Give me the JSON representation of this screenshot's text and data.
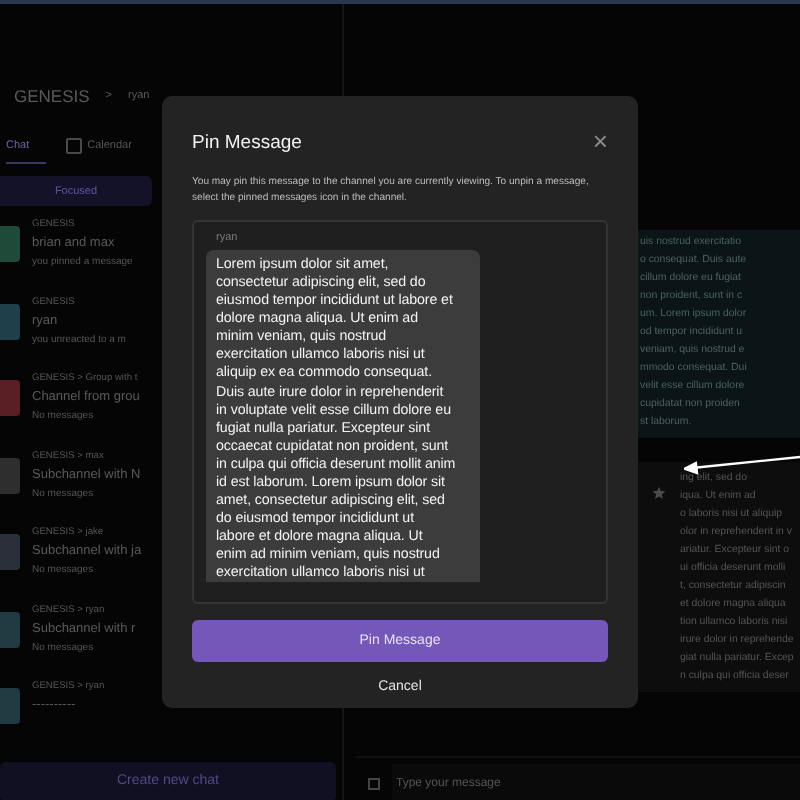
{
  "header": {
    "workspace": "GENESIS",
    "separator": ">",
    "user": "ryan"
  },
  "tabs": [
    {
      "label": "Chat",
      "selected": true
    },
    {
      "label": "Calendar",
      "selected": false
    }
  ],
  "filter": {
    "label": "Focused",
    "selected": true
  },
  "chats": [
    {
      "path": "GENESIS",
      "name": "brian and max",
      "preview": "you pinned a message",
      "color": "#1f4a3a"
    },
    {
      "path": "GENESIS",
      "name": "ryan",
      "preview": "you unreacted to a m",
      "color": "#1f3f4a"
    },
    {
      "path": "GENESIS > Group with t",
      "name": "Channel from grou",
      "preview": "No messages",
      "color": "#5a1f24"
    },
    {
      "path": "GENESIS > max",
      "name": "Subchannel with N",
      "preview": "No messages",
      "color": "#2e2e2e"
    },
    {
      "path": "GENESIS > jake",
      "name": "Subchannel with ja",
      "preview": "No messages",
      "color": "#2a2f3a"
    },
    {
      "path": "GENESIS > ryan",
      "name": "Subchannel with r",
      "preview": "No messages",
      "color": "#1f3a40"
    },
    {
      "path": "GENESIS > ryan",
      "name": "----------",
      "color": "#1f3a40"
    }
  ],
  "create_button": "Create new chat",
  "messages": [
    {
      "lines": [
        "uis nostrud exercitatio",
        "o consequat. Duis aute",
        "cillum dolore eu fugiat",
        "non proident, sunt in c",
        "um. Lorem ipsum dolor",
        "od tempor incididunt u",
        "veniam, quis nostrud e",
        "mmodo consequat. Dui",
        "velit esse cillum dolore",
        "cupidatat non proiden",
        "st laborum."
      ],
      "pinned": false
    },
    {
      "lines": [
        "ing elit, sed do",
        "iqua. Ut enim ad",
        "o laboris nisi ut aliquip",
        "olor in reprehenderit in v",
        "ariatur. Excepteur sint o",
        "ui officia deserunt molli",
        "t, consectetur adipiscin",
        "et dolore magna aliqua",
        "tion ullamco laboris nisi",
        "irure dolor in reprehende",
        "giat nulla pariatur. Excep",
        "n culpa qui officia deser"
      ],
      "pinned": true
    }
  ],
  "composer": {
    "placeholder": "Type your message"
  },
  "dialog": {
    "title": "Pin Message",
    "close": "×",
    "description": "You may pin this message to the channel you are currently viewing. To unpin a message, select the pinned messages icon in the channel.",
    "author": "ryan",
    "message": "Lorem ipsum dolor sit amet, consectetur adipiscing elit, sed do eiusmod tempor incididunt ut labore et dolore magna aliqua. Ut enim ad minim veniam, quis nostrud exercitation ullamco laboris nisi ut aliquip ex ea commodo consequat. Duis aute irure dolor in reprehenderit in voluptate velit esse cillum dolore eu fugiat nulla pariatur. Excepteur sint occaecat cupidatat non proident, sunt in culpa qui officia deserunt mollit anim id est laborum. Lorem ipsum dolor sit amet, consectetur adipiscing elit, sed do eiusmod tempor incididunt ut labore et dolore magna aliqua. Ut enim ad minim veniam, quis nostrud exercitation ullamco laboris nisi ut",
    "confirm": "Pin Message",
    "cancel": "Cancel"
  }
}
